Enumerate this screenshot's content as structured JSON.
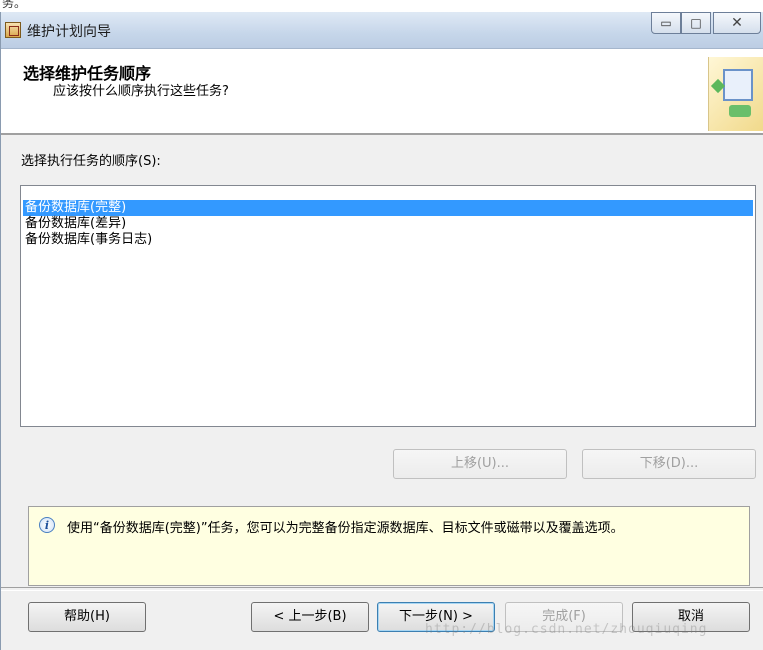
{
  "top_text": "务。",
  "window": {
    "title": "维护计划向导",
    "controls": {
      "minimize": "▭",
      "maximize": "□",
      "close": "✕"
    }
  },
  "header": {
    "title": "选择维护任务顺序",
    "subtitle": "应该按什么顺序执行这些任务?"
  },
  "task_list": {
    "label": "选择执行任务的顺序(S):",
    "items": [
      {
        "label": "备份数据库(完整)",
        "selected": true
      },
      {
        "label": "备份数据库(差异)",
        "selected": false
      },
      {
        "label": "备份数据库(事务日志)",
        "selected": false
      }
    ]
  },
  "move_buttons": {
    "up": "上移(U)...",
    "down": "下移(D)..."
  },
  "info": {
    "text": "使用“备份数据库(完整)”任务，您可以为完整备份指定源数据库、目标文件或磁带以及覆盖选项。"
  },
  "footer": {
    "help": "帮助(H)",
    "back": "< 上一步(B)",
    "next": "下一步(N) >",
    "finish": "完成(F)",
    "cancel": "取消"
  },
  "watermark": "http://blog.csdn.net/zhouqiuqing"
}
